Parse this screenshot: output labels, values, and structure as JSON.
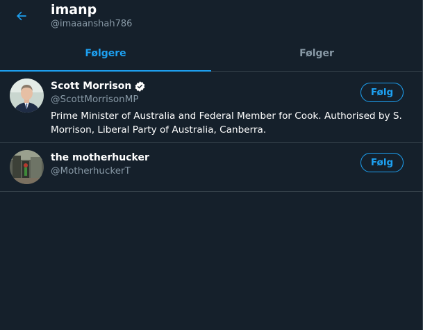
{
  "header": {
    "title": "imanp",
    "handle": "@imaaanshah786"
  },
  "tabs": [
    {
      "label": "Følgere",
      "active": true
    },
    {
      "label": "Følger",
      "active": false
    }
  ],
  "users": [
    {
      "name": "Scott Morrison",
      "verified": true,
      "handle": "@ScottMorrisonMP",
      "bio": "Prime Minister of Australia and Federal Member for Cook. Authorised by S. Morrison, Liberal Party of Australia, Canberra.",
      "follow_label": "Følg"
    },
    {
      "name": "the motherhucker",
      "verified": false,
      "handle": "@MotherhuckerT",
      "bio": "",
      "follow_label": "Følg"
    }
  ],
  "colors": {
    "background": "#15202b",
    "accent": "#1da1f2",
    "muted_text": "#8899a6",
    "border": "#38444d"
  }
}
